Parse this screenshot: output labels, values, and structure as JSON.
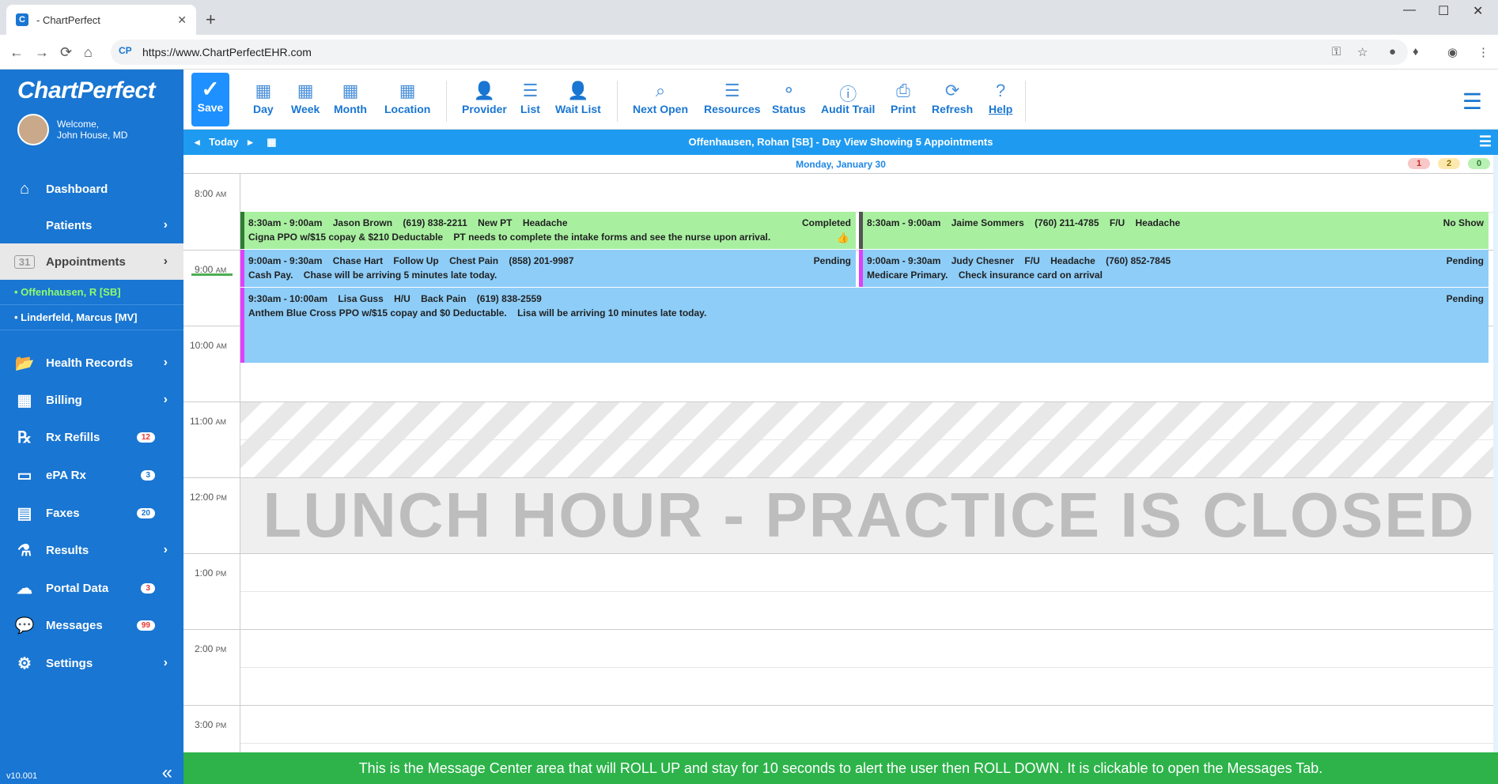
{
  "browser": {
    "tab_title": "- ChartPerfect",
    "url": "https://www.ChartPerfectEHR.com",
    "favicon_text": "C"
  },
  "sidebar": {
    "logo": "ChartPerfect",
    "welcome": "Welcome,",
    "user": "John House, MD",
    "items": [
      {
        "label": "Dashboard",
        "icon": "home-icon",
        "glyph": "⌂"
      },
      {
        "label": "Patients",
        "icon": "person-icon",
        "glyph": "👤",
        "chevron": "›"
      },
      {
        "label": "Appointments",
        "icon": "calendar-icon",
        "glyph": "31",
        "chevron": "›"
      },
      {
        "label": "Health Records",
        "icon": "folder-icon",
        "glyph": "📂",
        "chevron": "›"
      },
      {
        "label": "Billing",
        "icon": "calculator-icon",
        "glyph": "▦",
        "chevron": "›"
      },
      {
        "label": "Rx Refills",
        "icon": "rx-icon",
        "glyph": "℞",
        "badge": "12"
      },
      {
        "label": "ePA Rx",
        "icon": "card-icon",
        "glyph": "▭",
        "badge": "3"
      },
      {
        "label": "Faxes",
        "icon": "fax-icon",
        "glyph": "▤",
        "badge": "20"
      },
      {
        "label": "Results",
        "icon": "flask-icon",
        "glyph": "⚗",
        "chevron": "›"
      },
      {
        "label": "Portal Data",
        "icon": "cloud-icon",
        "glyph": "☁",
        "badge": "3"
      },
      {
        "label": "Messages",
        "icon": "chat-icon",
        "glyph": "💬",
        "badge": "99"
      },
      {
        "label": "Settings",
        "icon": "gear-icon",
        "glyph": "⚙",
        "chevron": "›"
      }
    ],
    "sub_items": [
      {
        "label": "• Offenhausen, R [SB]"
      },
      {
        "label": "• Linderfeld, Marcus [MV]"
      }
    ],
    "version": "v10.001",
    "collapse_glyph": "«"
  },
  "toolbar": {
    "save": "Save",
    "buttons": [
      {
        "label": "Day",
        "icon": "day-icon",
        "glyph": "▦"
      },
      {
        "label": "Week",
        "icon": "week-icon",
        "glyph": "▦"
      },
      {
        "label": "Month",
        "icon": "month-icon",
        "glyph": "▦"
      },
      {
        "label": "Location",
        "icon": "location-icon",
        "glyph": "▦"
      },
      {
        "label": "Provider",
        "icon": "provider-icon",
        "glyph": "👤"
      },
      {
        "label": "List",
        "icon": "list-icon",
        "glyph": "☰"
      },
      {
        "label": "Wait List",
        "icon": "waitlist-icon",
        "glyph": "👤"
      },
      {
        "label": "Next Open",
        "icon": "search-icon",
        "glyph": "⌕"
      },
      {
        "label": "Resources",
        "icon": "sliders-icon",
        "glyph": "☰"
      },
      {
        "label": "Status",
        "icon": "status-icon",
        "glyph": "⚬"
      },
      {
        "label": "Audit Trail",
        "icon": "info-icon",
        "glyph": "ⓘ"
      },
      {
        "label": "Print",
        "icon": "print-icon",
        "glyph": "⎙"
      },
      {
        "label": "Refresh",
        "icon": "refresh-icon",
        "glyph": "⟳"
      },
      {
        "label": "Help",
        "icon": "help-icon",
        "glyph": "?"
      }
    ]
  },
  "datebar": {
    "today": "Today",
    "title": "Offenhausen, Rohan  [SB]  -  Day View  Showing 5 Appointments"
  },
  "calendar": {
    "date": "Monday, January 30",
    "counts": [
      {
        "value": "1",
        "bg": "#f8c8c8",
        "fg": "#c62828"
      },
      {
        "value": "2",
        "bg": "#fde9b0",
        "fg": "#8d6e00"
      },
      {
        "value": "0",
        "bg": "#b9f0b4",
        "fg": "#2e7d32"
      }
    ],
    "times": [
      {
        "time": "8:00",
        "ampm": "AM"
      },
      {
        "time": "9:00",
        "ampm": "AM"
      },
      {
        "time": "10:00",
        "ampm": "AM"
      },
      {
        "time": "11:00",
        "ampm": "AM"
      },
      {
        "time": "12:00",
        "ampm": "PM"
      },
      {
        "time": "1:00",
        "ampm": "PM"
      },
      {
        "time": "2:00",
        "ampm": "PM"
      },
      {
        "time": "3:00",
        "ampm": "PM"
      }
    ],
    "appointments": [
      {
        "line1": "8:30am - 9:00am    Jason Brown    (619) 838-2211    New PT    Headache",
        "line2": "Cigna PPO w/$15 copay & $210 Deductable    PT needs to complete the intake forms and see the nurse upon arrival.",
        "status": "Completed",
        "bar": "#2e7d32"
      },
      {
        "line1": "8:30am - 9:00am    Jaime Sommers    (760) 211-4785    F/U    Headache",
        "line2": "",
        "status": "No Show",
        "bar": "#555555"
      },
      {
        "line1": "9:00am - 9:30am    Chase Hart    Follow Up    Chest Pain    (858) 201-9987",
        "line2": "Cash Pay.    Chase will be arriving 5 minutes late today.",
        "status": "Pending",
        "bar": "#e040fb"
      },
      {
        "line1": "9:00am - 9:30am    Judy Chesner    F/U    Headache    (760) 852-7845",
        "line2": "Medicare Primary.    Check insurance card on arrival",
        "status": "Pending",
        "bar": "#e040fb"
      },
      {
        "line1": "9:30am - 10:00am    Lisa Guss    H/U    Back Pain    (619) 838-2559",
        "line2": "Anthem Blue Cross PPO w/$15 copay and $0 Deductable.    Lisa will be arriving 10 minutes late today.",
        "status": "Pending",
        "bar": "#e040fb"
      }
    ],
    "lunch": "LUNCH HOUR - PRACTICE IS CLOSED"
  },
  "message_bar": "This is the Message Center area that will ROLL UP and stay for 10 seconds to alert the user then ROLL DOWN. It is clickable to open the Messages Tab."
}
